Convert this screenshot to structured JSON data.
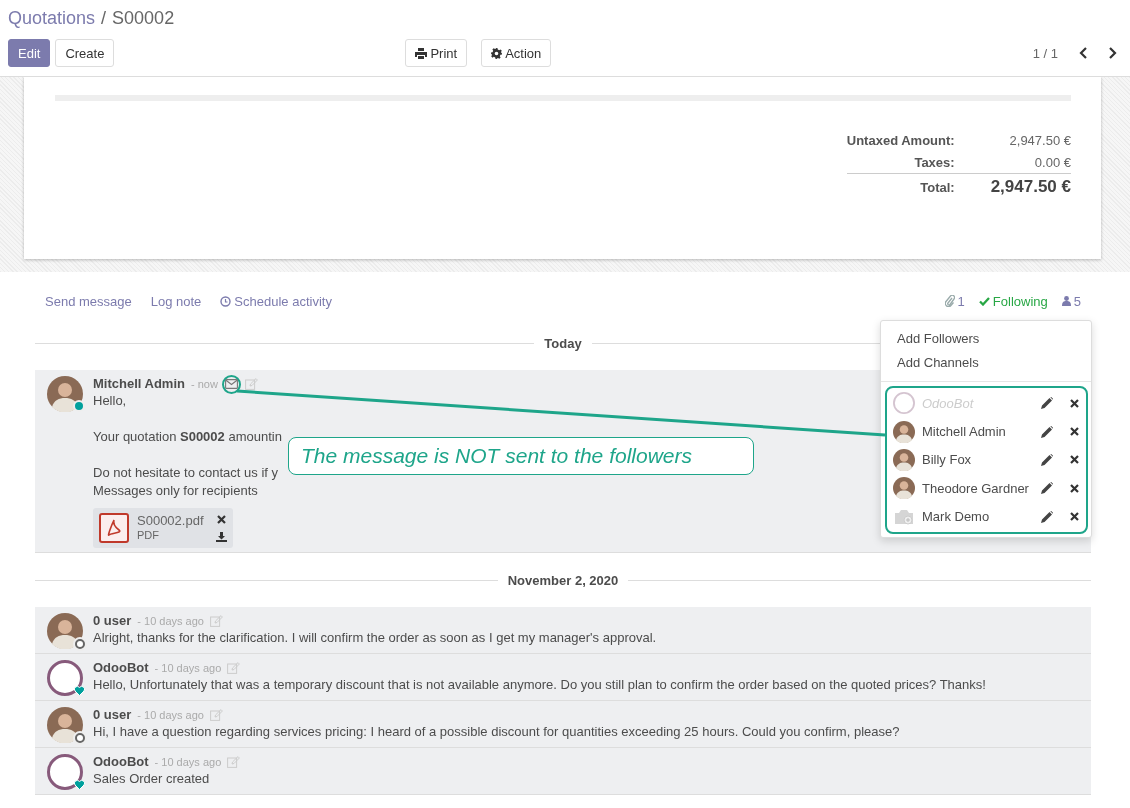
{
  "breadcrumb": {
    "parent": "Quotations",
    "separator": "/",
    "current": "S00002"
  },
  "buttons": {
    "edit": "Edit",
    "create": "Create",
    "print": "Print",
    "action": "Action"
  },
  "pager": {
    "counter": "1 / 1"
  },
  "totals": [
    {
      "kind": "line",
      "label": "Untaxed Amount:",
      "value": "2,947.50 €"
    },
    {
      "kind": "line",
      "label": "Taxes:",
      "value": "0.00 €"
    },
    {
      "kind": "total",
      "label": "Total:",
      "value": "2,947.50 €"
    }
  ],
  "chatter": {
    "actions": [
      "Send message",
      "Log note",
      "Schedule activity"
    ],
    "attachments": "1",
    "follow": {
      "label": "Following",
      "following": true
    },
    "followers_count": "5"
  },
  "days": [
    {
      "label": "Today",
      "messages": [
        {
          "author": "Mitchell Admin",
          "date": "- now",
          "kind": "user",
          "online": true,
          "envelope": true,
          "highlighted": true,
          "paragraphs": [
            [
              "Hello,"
            ],
            [
              "Your quotation **S00002** amountin"
            ],
            [
              "Do not hesitate to contact us if y",
              "Messages only for recipients"
            ]
          ],
          "attachment": {
            "name": "S00002.pdf",
            "type": "PDF"
          }
        }
      ]
    },
    {
      "label": "November 2, 2020",
      "messages": [
        {
          "author": "0 user",
          "date": "- 10 days ago",
          "kind": "user",
          "online": false,
          "envelope": false,
          "paragraphs": [
            [
              "Alright, thanks for the clarification. I will confirm the order as soon as I get my manager's approval."
            ]
          ]
        },
        {
          "author": "OdooBot",
          "date": "- 10 days ago",
          "kind": "bot",
          "online": true,
          "envelope": false,
          "paragraphs": [
            [
              "Hello, Unfortunately that was a temporary discount that is not available anymore. Do you still plan to confirm the order based on the quoted prices? Thanks!"
            ]
          ]
        },
        {
          "author": "0 user",
          "date": "- 10 days ago",
          "kind": "user",
          "online": false,
          "envelope": false,
          "paragraphs": [
            [
              "Hi, I have a question regarding services pricing: I heard of a possible discount for quantities exceeding 25 hours. Could you confirm, please?"
            ]
          ]
        },
        {
          "author": "OdooBot",
          "date": "- 10 days ago",
          "kind": "bot",
          "online": true,
          "envelope": false,
          "paragraphs": [
            [
              "Sales Order created"
            ]
          ]
        }
      ]
    }
  ],
  "followers_menu": {
    "actions": [
      "Add Followers",
      "Add Channels"
    ],
    "followers": [
      {
        "name": "OdooBot",
        "kind": "bot",
        "inactive": true
      },
      {
        "name": "Mitchell Admin",
        "kind": "user",
        "inactive": false
      },
      {
        "name": "Billy Fox",
        "kind": "user",
        "inactive": false
      },
      {
        "name": "Theodore Gardner",
        "kind": "user",
        "inactive": false
      },
      {
        "name": "Mark Demo",
        "kind": "no_photo",
        "inactive": false
      }
    ]
  },
  "callout": "The message is NOT sent to the followers"
}
